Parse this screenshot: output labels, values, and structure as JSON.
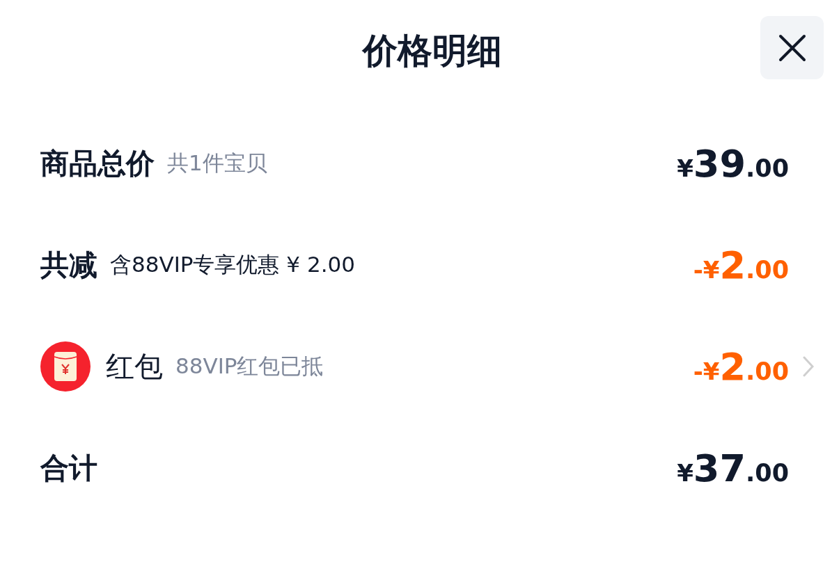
{
  "title": "价格明细",
  "rows": [
    {
      "kind": "plain",
      "label": "商品总价",
      "label_bold": true,
      "note": "共1件宝贝",
      "note_muted": true,
      "price": {
        "currency": "¥",
        "integer": "39",
        "decimal": ".00"
      },
      "discount": false
    },
    {
      "kind": "plain",
      "label": "共减",
      "label_bold": true,
      "note": "含88VIP专享优惠 ¥ 2.00",
      "note_muted": false,
      "price": {
        "sign": "-",
        "currency": "¥",
        "integer": "2",
        "decimal": ".00"
      },
      "discount": true
    },
    {
      "kind": "red-packet",
      "label": "红包",
      "label_bold": false,
      "note": "88VIP红包已抵",
      "note_muted": true,
      "price": {
        "sign": "-",
        "currency": "¥",
        "integer": "2",
        "decimal": ".00"
      },
      "discount": true
    },
    {
      "kind": "plain",
      "label": "合计",
      "label_bold": true,
      "price": {
        "currency": "¥",
        "integer": "37",
        "decimal": ".00"
      },
      "discount": false
    }
  ]
}
